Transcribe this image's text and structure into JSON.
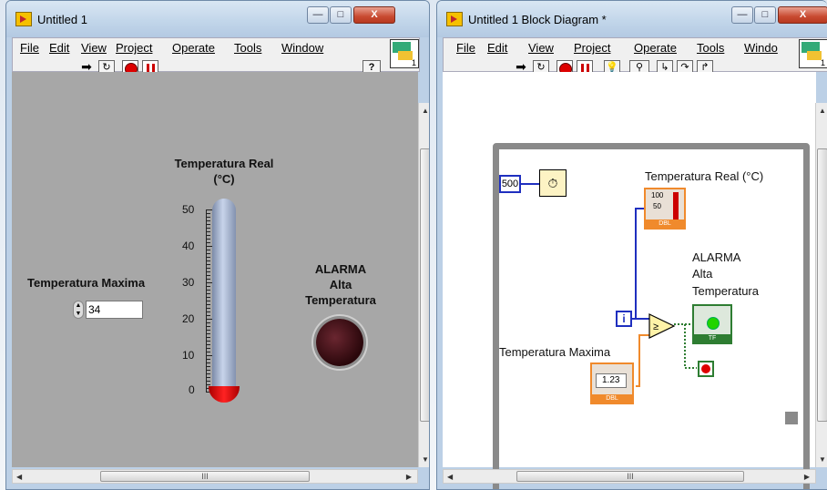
{
  "front_panel": {
    "title": "Untitled 1",
    "menus": [
      "File",
      "Edit",
      "View",
      "Project",
      "Operate",
      "Tools",
      "Window"
    ],
    "help_glyph": "?",
    "vi_icon_number": "1",
    "indicator_label_1": "Temperatura Real",
    "indicator_label_2": "(°C)",
    "ticks": [
      "50",
      "40",
      "30",
      "20",
      "10",
      "0"
    ],
    "control_label": "Temperatura Maxima",
    "control_value": "34",
    "alarm_label_1": "ALARMA",
    "alarm_label_2": "Alta",
    "alarm_label_3": "Temperatura",
    "scroll_glyph": "III"
  },
  "block_diagram": {
    "title": "Untitled 1 Block Diagram *",
    "menus": [
      "File",
      "Edit",
      "View",
      "Project",
      "Operate",
      "Tools",
      "Windo"
    ],
    "vi_icon_number": "1",
    "wait_const": "500",
    "therm_label": "Temperatura Real (°C)",
    "therm_term_top": "100",
    "therm_term_mid": "50",
    "dbl_tag": "DBL",
    "alarm_label_1": "ALARMA",
    "alarm_label_2": "Alta",
    "alarm_label_3": "Temperatura",
    "tf_tag": "TF",
    "iter_label": "i",
    "ctrl_label": "Temperatura Maxima",
    "ctrl_value": "1.23",
    "scroll_glyph": "III"
  },
  "colors": {
    "panel_bg": "#a7a7a7",
    "wire_blue": "#1f2fbf",
    "wire_orange": "#f08a2c",
    "wire_green": "#2e7d32",
    "led_green": "#21d400",
    "alarm_off": "#2a070b"
  },
  "icons": {
    "run": "arrow-icon",
    "run_cont": "loop-arrow-icon",
    "abort": "stop-icon",
    "pause": "pause-icon",
    "help": "question-icon",
    "highlight": "lightbulb-icon",
    "probe": "probe-icon",
    "step_into": "step-into-icon",
    "step_over": "step-over-icon",
    "step_out": "step-out-icon",
    "timer": "stopwatch-icon"
  }
}
